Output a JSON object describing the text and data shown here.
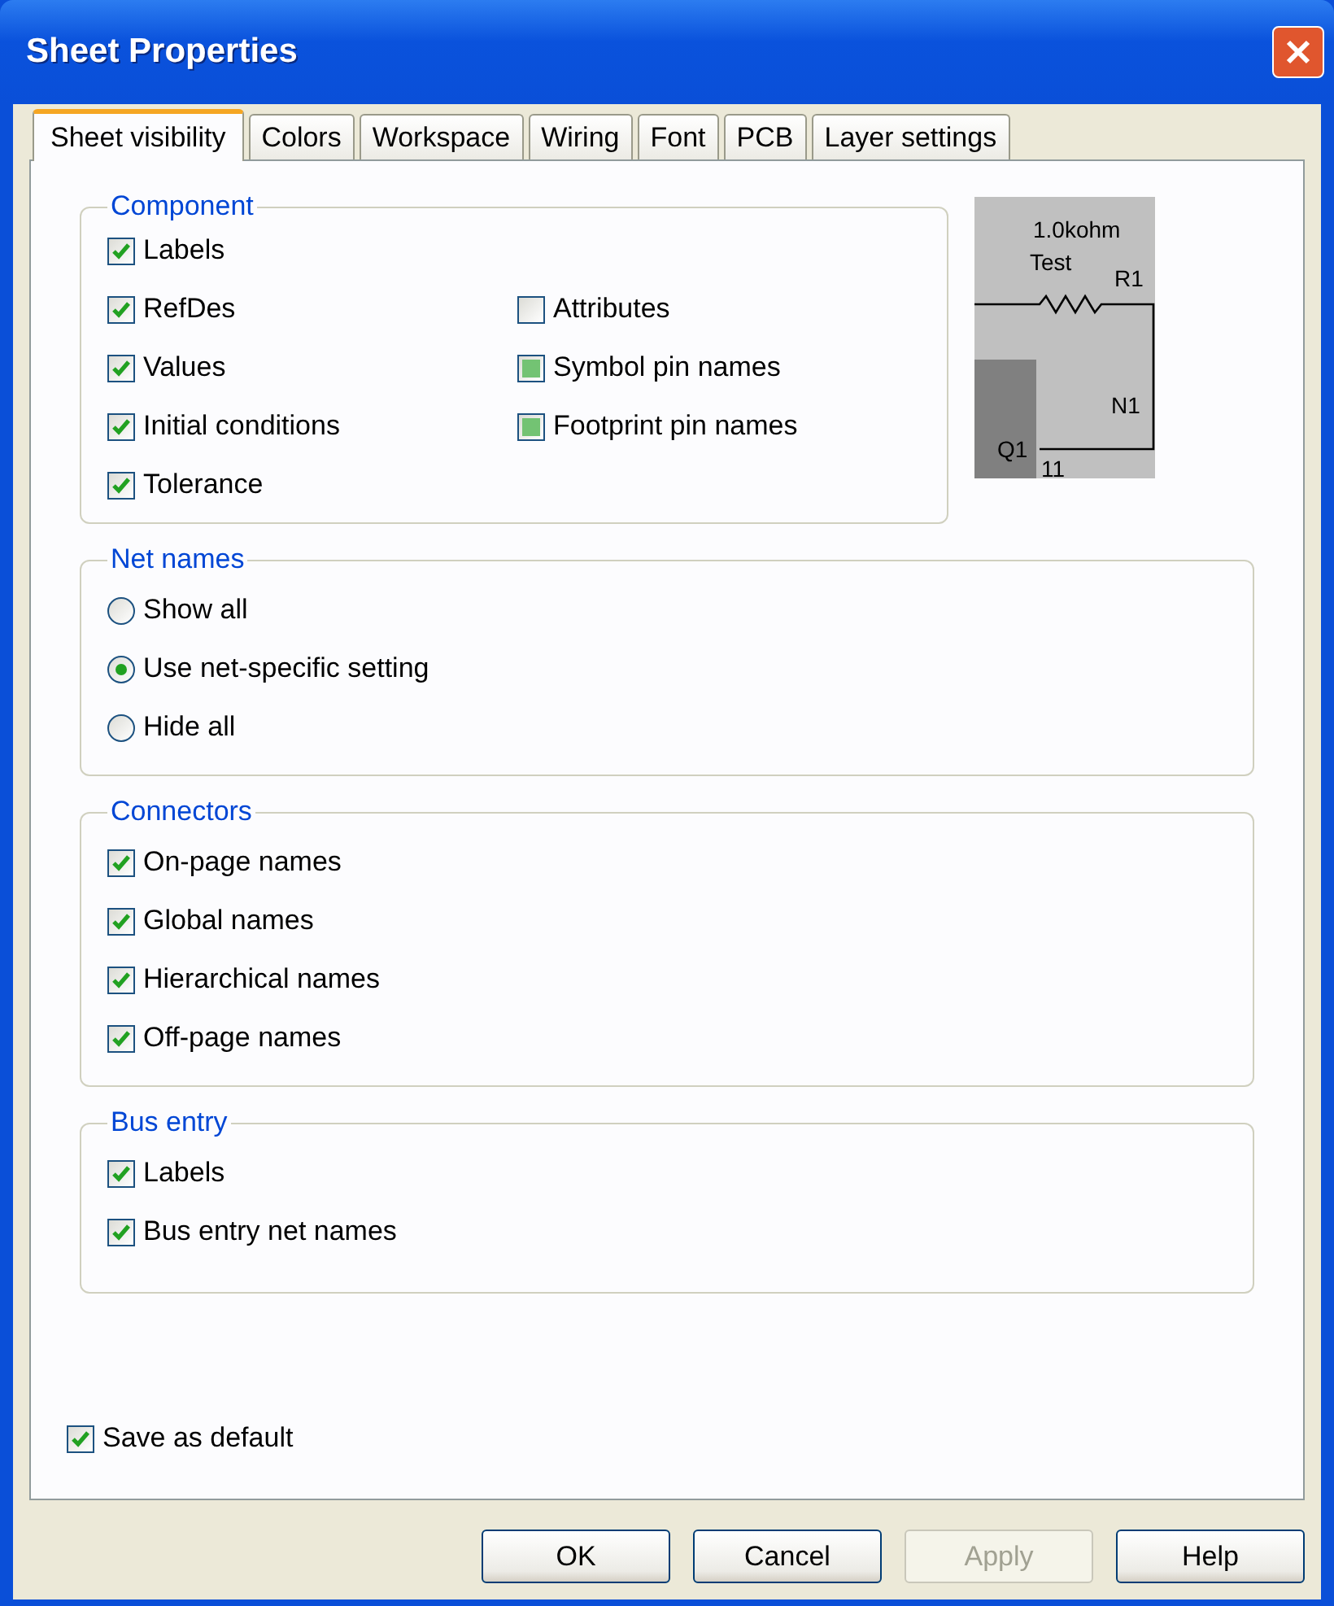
{
  "window": {
    "title": "Sheet Properties"
  },
  "tabs": [
    {
      "label": "Sheet visibility",
      "selected": true
    },
    {
      "label": "Colors",
      "selected": false
    },
    {
      "label": "Workspace",
      "selected": false
    },
    {
      "label": "Wiring",
      "selected": false
    },
    {
      "label": "Font",
      "selected": false
    },
    {
      "label": "PCB",
      "selected": false
    },
    {
      "label": "Layer settings",
      "selected": false
    }
  ],
  "component": {
    "title": "Component",
    "left_column": [
      {
        "label": "Labels",
        "checked": true,
        "indeterminate": false
      },
      {
        "label": "RefDes",
        "checked": true,
        "indeterminate": false
      },
      {
        "label": "Values",
        "checked": true,
        "indeterminate": false
      },
      {
        "label": "Initial conditions",
        "checked": true,
        "indeterminate": false
      },
      {
        "label": "Tolerance",
        "checked": true,
        "indeterminate": false
      }
    ],
    "right_column": [
      {
        "label": "Attributes",
        "checked": false,
        "indeterminate": false
      },
      {
        "label": "Symbol pin names",
        "checked": false,
        "indeterminate": true
      },
      {
        "label": "Footprint pin names",
        "checked": false,
        "indeterminate": true
      }
    ]
  },
  "preview": {
    "value": "1.0kohm",
    "tolerance": "Test",
    "refdes": "R1",
    "net": "N1",
    "part": "Q1",
    "pin": "11"
  },
  "net_names": {
    "title": "Net names",
    "options": [
      {
        "label": "Show all",
        "selected": false
      },
      {
        "label": "Use net-specific setting",
        "selected": true
      },
      {
        "label": "Hide all",
        "selected": false
      }
    ]
  },
  "connectors": {
    "title": "Connectors",
    "items": [
      {
        "label": "On-page names",
        "checked": true
      },
      {
        "label": "Global names",
        "checked": true
      },
      {
        "label": "Hierarchical names",
        "checked": true
      },
      {
        "label": "Off-page names",
        "checked": true
      }
    ]
  },
  "bus_entry": {
    "title": "Bus entry",
    "items": [
      {
        "label": "Labels",
        "checked": true
      },
      {
        "label": "Bus entry net names",
        "checked": true
      }
    ]
  },
  "save_as_default": {
    "label": "Save as default",
    "checked": true
  },
  "buttons": [
    {
      "label": "OK",
      "disabled": false
    },
    {
      "label": "Cancel",
      "disabled": false
    },
    {
      "label": "Apply",
      "disabled": true
    },
    {
      "label": "Help",
      "disabled": false
    }
  ]
}
